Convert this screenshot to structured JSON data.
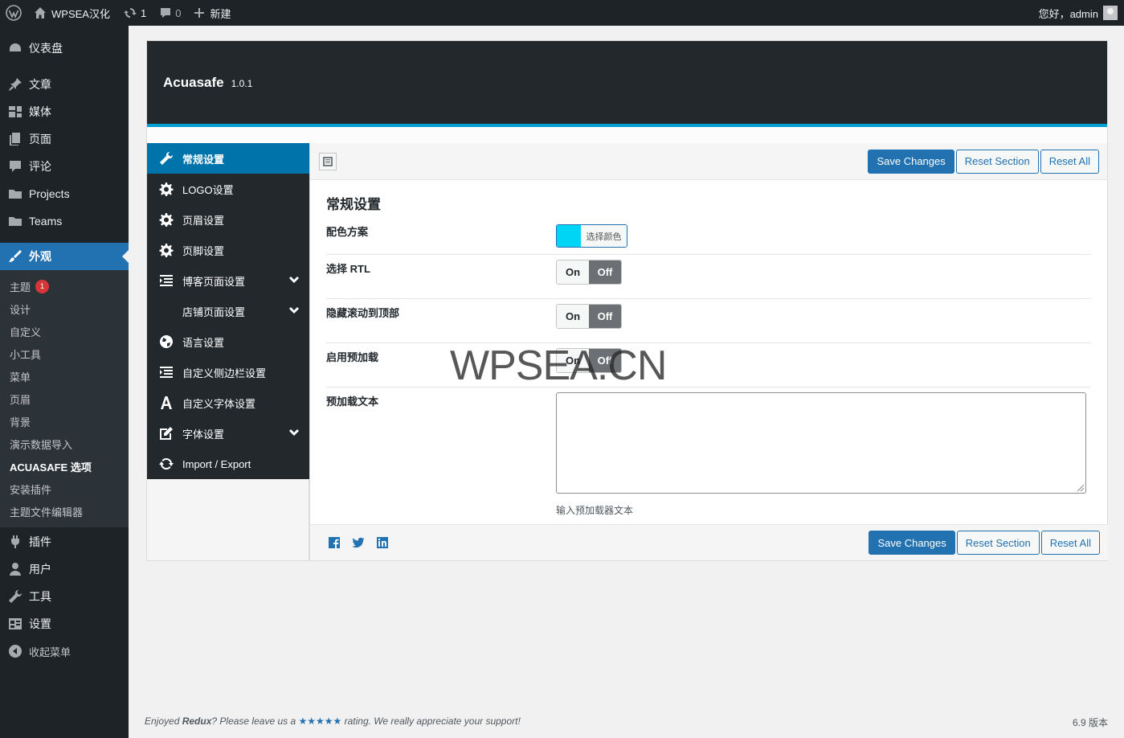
{
  "adminbar": {
    "site_name": "WPSEA汉化",
    "updates_count": "1",
    "comments_count": "0",
    "new_label": "新建",
    "greeting": "您好，admin"
  },
  "sidebar": {
    "dashboard": "仪表盘",
    "posts": "文章",
    "media": "媒体",
    "pages": "页面",
    "comments": "评论",
    "projects": "Projects",
    "teams": "Teams",
    "appearance": "外观",
    "submenu": {
      "themes": "主题",
      "themes_badge": "1",
      "design": "设计",
      "customize": "自定义",
      "widgets": "小工具",
      "menus": "菜单",
      "header": "页眉",
      "background": "背景",
      "demo_import": "演示数据导入",
      "acuasafe_options": "ACUASAFE 选项",
      "install_plugins": "安装插件",
      "theme_editor": "主题文件编辑器"
    },
    "plugins": "插件",
    "users": "用户",
    "tools": "工具",
    "settings": "设置",
    "collapse": "收起菜单"
  },
  "redux": {
    "title": "Acuasafe",
    "version": "1.0.1",
    "nav": [
      "常规设置",
      "LOGO设置",
      "页眉设置",
      "页脚设置",
      "博客页面设置",
      "店铺页面设置",
      "语言设置",
      "自定义侧边栏设置",
      "自定义字体设置",
      "字体设置",
      "Import / Export"
    ],
    "buttons": {
      "save": "Save Changes",
      "reset_section": "Reset Section",
      "reset_all": "Reset All"
    },
    "section_title": "常规设置",
    "fields": {
      "color_scheme_label": "配色方案",
      "color_pick_text": "选择颜色",
      "color_value": "#00d5f5",
      "rtl_label": "选择 RTL",
      "hide_scroll_label": "隐藏滚动到顶部",
      "preload_label": "启用预加载",
      "on": "On",
      "off": "Off",
      "preload_text_label": "预加载文本",
      "preload_text_desc": "输入预加载器文本"
    }
  },
  "watermark": "WPSEA.CN",
  "footer": {
    "thanks_prefix": "Enjoyed ",
    "redux": "Redux",
    "thanks_mid": "? Please leave us a ",
    "stars": "★★★★★",
    "thanks_suffix": " rating. We really appreciate your support!",
    "version": "6.9 版本"
  }
}
